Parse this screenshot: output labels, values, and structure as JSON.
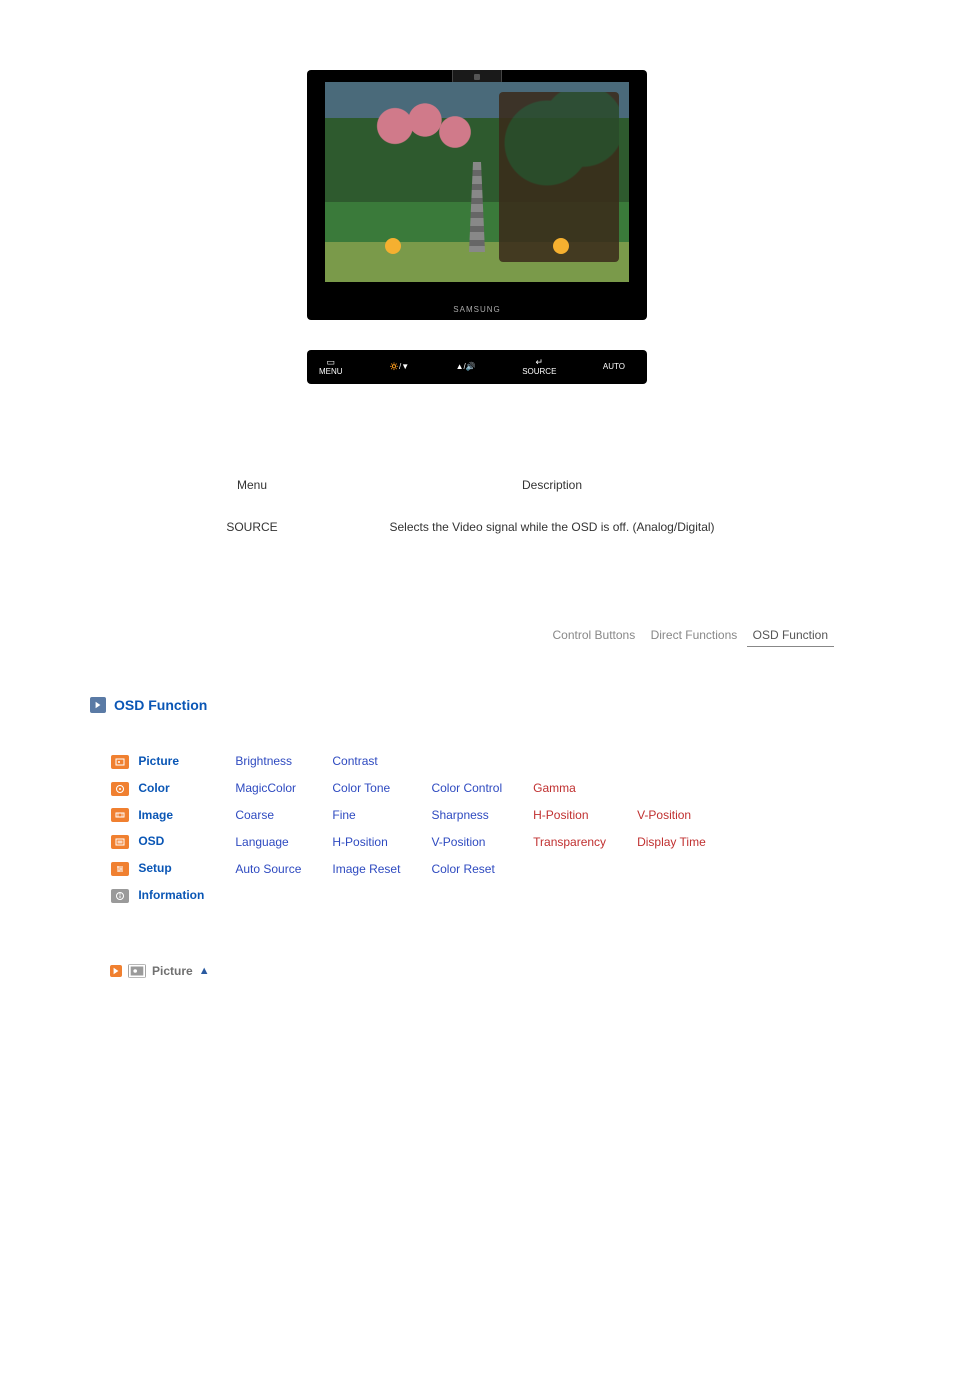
{
  "monitor": {
    "brand": "SAMSUNG"
  },
  "button_bar": {
    "b1_icon": "▭",
    "b1_label": "MENU",
    "b2_label": "🔅/▼",
    "b3_label": "▲/🔊",
    "b4_icon": "↵",
    "b4_label": "SOURCE",
    "b5_label": "AUTO"
  },
  "desc": {
    "h_menu": "Menu",
    "h_desc": "Description",
    "row1_menu": "SOURCE",
    "row1_desc": "Selects the Video signal while the OSD is off. (Analog/Digital)"
  },
  "tabs": {
    "t1": "Control Buttons",
    "t2": "Direct Functions",
    "t3": "OSD Function"
  },
  "section": {
    "title": "OSD Function"
  },
  "rows": {
    "picture": {
      "cat": "Picture",
      "c1": "Brightness",
      "c2": "Contrast"
    },
    "color": {
      "cat": "Color",
      "c1": "MagicColor",
      "c2": "Color Tone",
      "c3": "Color Control",
      "c4": "Gamma"
    },
    "image": {
      "cat": "Image",
      "c1": "Coarse",
      "c2": "Fine",
      "c3": "Sharpness",
      "c4": "H-Position",
      "c5": "V-Position"
    },
    "osd": {
      "cat": "OSD",
      "c1": "Language",
      "c2": "H-Position",
      "c3": "V-Position",
      "c4": "Transparency",
      "c5": "Display Time"
    },
    "setup": {
      "cat": "Setup",
      "c1": "Auto Source",
      "c2": "Image Reset",
      "c3": "Color Reset"
    },
    "info": {
      "cat": "Information"
    }
  },
  "sub": {
    "title": "Picture"
  }
}
